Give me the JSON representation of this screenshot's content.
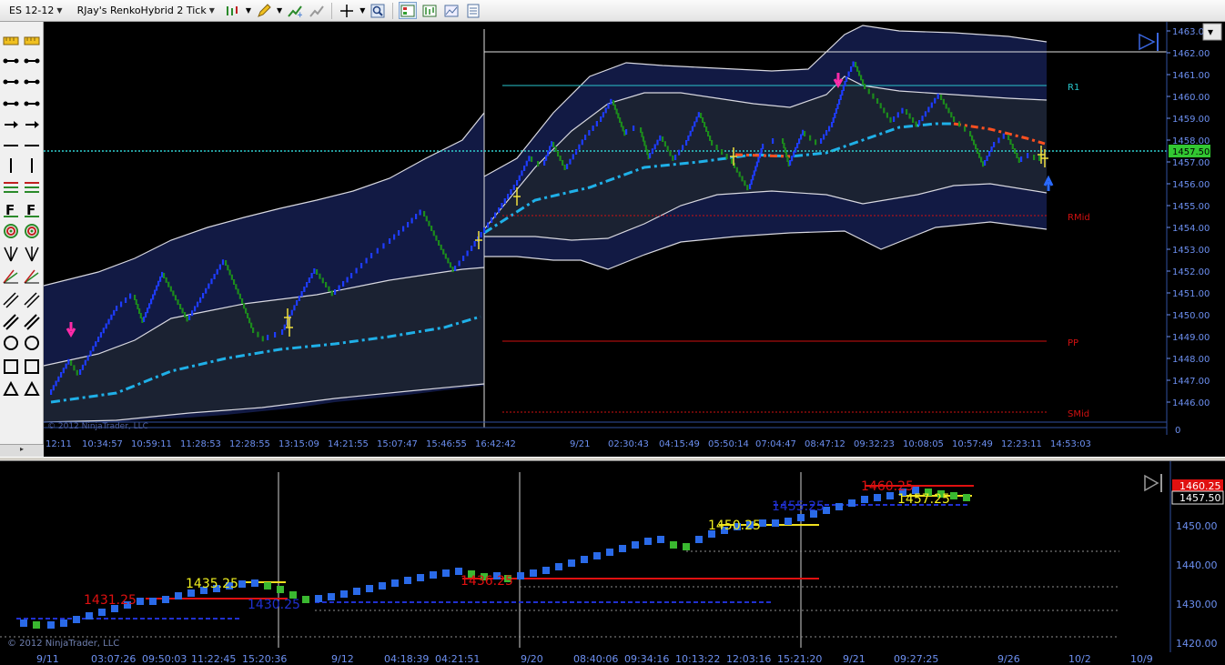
{
  "toolbar": {
    "instrument": "ES 12-12",
    "chart_type": "RJay's RenkoHybrid  2 Tick",
    "icons": [
      "bar-type-icon",
      "pencil-icon",
      "add-indicator-icon",
      "strategy-icon",
      "crosshair-icon",
      "zoom-icon",
      "data-box-icon",
      "chart-trader-icon",
      "templates-icon",
      "properties-icon"
    ]
  },
  "upper_chart": {
    "price_axis": [
      "1463.00",
      "1462.00",
      "1461.00",
      "1460.00",
      "1459.00",
      "1458.00",
      "1457.00",
      "1456.00",
      "1455.00",
      "1454.00",
      "1453.00",
      "1452.00",
      "1451.00",
      "1450.00",
      "1449.00",
      "1448.00",
      "1447.00",
      "1446.00"
    ],
    "current_price": "1457.50",
    "time_axis": [
      "12:11",
      "10:34:57",
      "10:59:11",
      "11:28:53",
      "12:28:55",
      "13:15:09",
      "14:21:55",
      "15:07:47",
      "15:46:55",
      "16:42:42",
      "9/21",
      "02:30:43",
      "04:15:49",
      "05:50:14",
      "07:04:47",
      "08:47:12",
      "09:32:23",
      "10:08:05",
      "10:57:49",
      "12:23:11",
      "14:53:03"
    ],
    "zero_label": "0",
    "pivot_labels": {
      "r1": "R1",
      "rmid": "RMid",
      "pp": "PP",
      "smid": "SMid"
    },
    "copyright": "© 2012 NinjaTrader, LLC"
  },
  "lower_chart": {
    "price_axis": [
      "1450.00",
      "1440.00",
      "1430.00",
      "1420.00"
    ],
    "price_tags": [
      "1460.25",
      "1457.50"
    ],
    "time_axis": [
      "9/11",
      "03:07:26",
      "09:50:03",
      "11:22:45",
      "15:20:36",
      "9/12",
      "04:18:39",
      "04:21:51",
      "9/20",
      "08:40:06",
      "09:34:16",
      "10:13:22",
      "12:03:16",
      "15:21:20",
      "9/21",
      "09:27:25",
      "9/26",
      "10/2",
      "10/9"
    ],
    "annotations": [
      "1431.25",
      "1435.25",
      "1430.25",
      "1436.25",
      "1450.25",
      "1455.25",
      "1460.25",
      "1457.25"
    ],
    "copyright": "© 2012 NinjaTrader, LLC"
  },
  "colors": {
    "background": "#000000",
    "axis_text": "#6c8ff0",
    "bull_brick": "#1e3cff",
    "bear_brick": "#1c8c1c",
    "mid_band": "#1fb0e8",
    "pivot_red": "#d01010",
    "r1_cyan": "#29c6cc",
    "price_tag": "#32c832"
  }
}
